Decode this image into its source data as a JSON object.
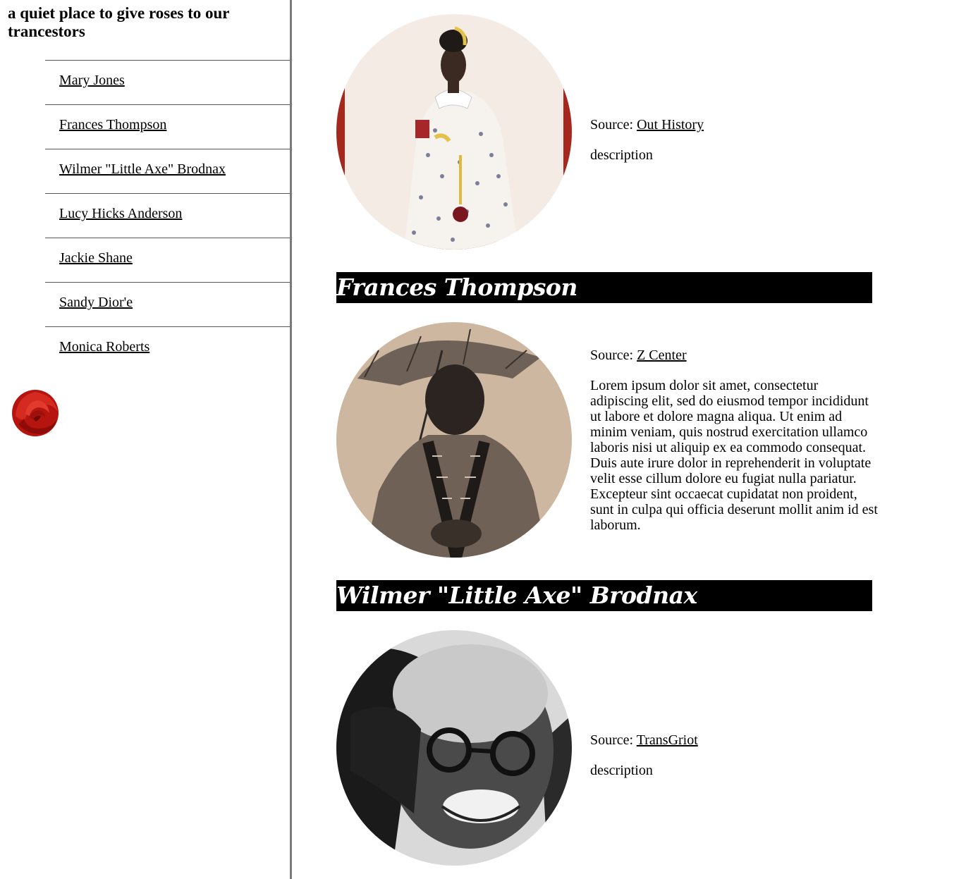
{
  "sidebar": {
    "title": "a quiet place to give roses to our trancestors",
    "nav": [
      "Mary Jones",
      "Frances Thompson",
      "Wilmer \"Little Axe\" Brodnax",
      "Lucy Hicks Anderson",
      "Jackie Shane",
      "Sandy Dior'e",
      "Monica Roberts"
    ],
    "rose_icon": "rose-icon"
  },
  "entries": [
    {
      "source_label": "Source:",
      "source_link": "Out History",
      "description": "description"
    },
    {
      "name": "Frances Thompson",
      "source_label": "Source:",
      "source_link": "Z Center",
      "description": "Lorem ipsum dolor sit amet, consectetur adipiscing elit, sed do eiusmod tempor incididunt ut labore et dolore magna aliqua. Ut enim ad minim veniam, quis nostrud exercitation ullamco laboris nisi ut aliquip ex ea commodo consequat. Duis aute irure dolor in reprehenderit in voluptate velit esse cillum dolore eu fugiat nulla pariatur. Excepteur sint occaecat cupidatat non proident, sunt in culpa qui officia deserunt mollit anim id est laborum."
    },
    {
      "name": "Wilmer \"Little Axe\" Brodnax",
      "source_label": "Source:",
      "source_link": "TransGriot",
      "description": "description"
    }
  ],
  "colors": {
    "bar_bg": "#000000",
    "rose_red": "#b5140f",
    "frame_red": "#a5271e"
  }
}
